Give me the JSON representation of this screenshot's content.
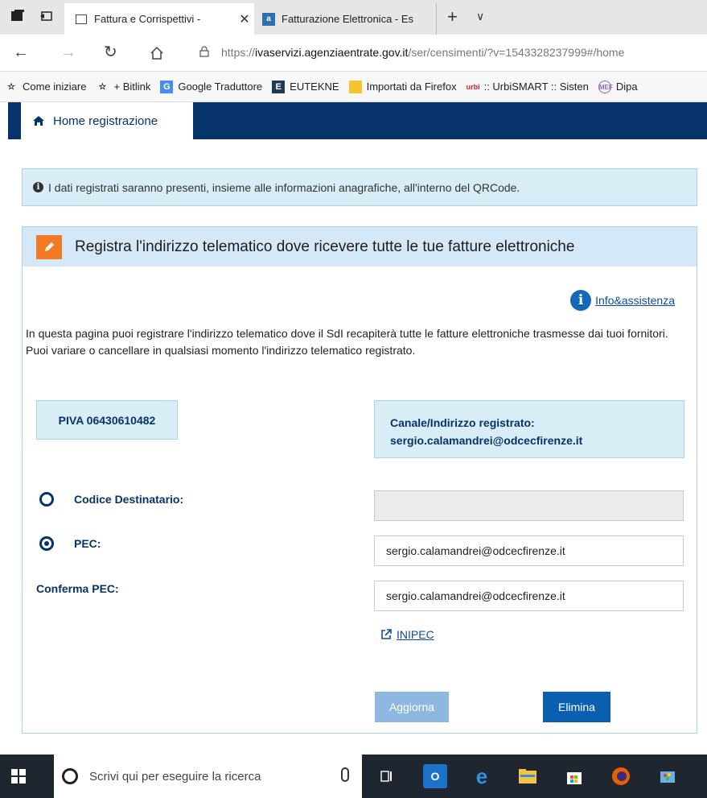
{
  "browser": {
    "tabs": [
      {
        "title": "Fattura e Corrispettivi -",
        "active": true
      },
      {
        "title": "Fatturazione Elettronica - Es",
        "active": false
      }
    ],
    "url_prefix": "https://",
    "url_host": "ivaservizi.agenziaentrate.gov.it",
    "url_path": "/ser/censimenti/?v=1543328237999#/home",
    "favorites": [
      {
        "label": "Come iniziare",
        "icon": "star-icon"
      },
      {
        "label": "+ Bitlink",
        "icon": "star-icon"
      },
      {
        "label": "Google Traduttore",
        "icon": "translate-icon"
      },
      {
        "label": "EUTEKNE",
        "icon": "eutekne-icon"
      },
      {
        "label": "Importati da Firefox",
        "icon": "folder-icon"
      },
      {
        "label": ":: UrbiSMART :: Sisten",
        "icon": "urbi-icon"
      },
      {
        "label": "Dipa",
        "icon": "mef-icon"
      }
    ]
  },
  "topnav": {
    "home_label": "Home registrazione"
  },
  "alert": {
    "text": "I dati registrati saranno presenti, insieme alle informazioni anagrafiche, all'interno del QRCode."
  },
  "panel": {
    "title": "Registra l'indirizzo telematico dove ricevere tutte le tue fatture elettroniche",
    "help_link": "Info&assistenza",
    "intro": "In questa pagina puoi registrare l'indirizzo telematico dove il SdI recapiterà tutte le fatture elettroniche trasmesse dai tuoi fornitori. Puoi variare o cancellare in qualsiasi momento l'indirizzo telematico registrato.",
    "piva": "PIVA 06430610482",
    "canale_label": "Canale/Indirizzo registrato:",
    "canale_value": "sergio.calamandrei@odcecfirenze.it",
    "codice_label": "Codice Destinatario:",
    "codice_value": "",
    "pec_label": "PEC:",
    "pec_value": "sergio.calamandrei@odcecfirenze.it",
    "conferma_label": "Conferma PEC:",
    "conferma_value": "sergio.calamandrei@odcecfirenze.it",
    "inipec_link": "INIPEC",
    "btn_aggiorna": "Aggiorna",
    "btn_elimina": "Elimina",
    "selected_option": "PEC"
  },
  "taskbar": {
    "search_placeholder": "Scrivi qui per eseguire la ricerca"
  },
  "colors": {
    "brand_navy": "#06336a",
    "accent_orange": "#f27a24",
    "info_bg": "#d8edf6",
    "primary_button": "#0a5fb0",
    "disabled_button": "#8fb8e1"
  }
}
